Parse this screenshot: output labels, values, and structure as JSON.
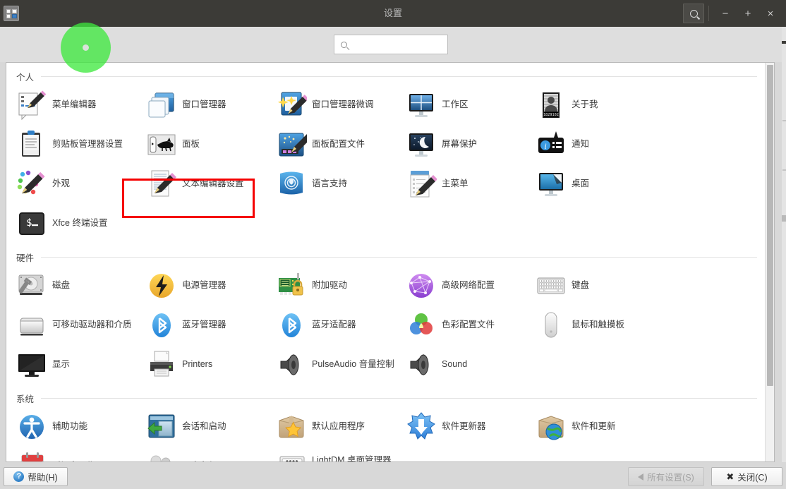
{
  "window": {
    "title": "设置",
    "icon": "settings-window-icon",
    "controls": {
      "search": "search-icon",
      "minimize": "−",
      "maximize": "+",
      "close": "×"
    }
  },
  "search": {
    "value": "",
    "placeholder": "",
    "icon": "search-icon"
  },
  "sections": [
    {
      "id": "personal",
      "title": "个人",
      "items": [
        {
          "label": "菜单编辑器",
          "icon": "menu-editor-icon"
        },
        {
          "label": "窗口管理器",
          "icon": "window-manager-icon"
        },
        {
          "label": "窗口管理器微调",
          "icon": "window-manager-tweaks-icon"
        },
        {
          "label": "工作区",
          "icon": "workspaces-icon"
        },
        {
          "label": "关于我",
          "icon": "about-me-icon",
          "badge": "1829102"
        },
        {
          "label": "剪贴板管理器设置",
          "icon": "clipboard-manager-icon"
        },
        {
          "label": "面板",
          "icon": "panel-icon",
          "highlighted": true
        },
        {
          "label": "面板配置文件",
          "icon": "panel-profiles-icon"
        },
        {
          "label": "屏幕保护",
          "icon": "screensaver-icon"
        },
        {
          "label": "通知",
          "icon": "notifications-icon"
        },
        {
          "label": "外观",
          "icon": "appearance-icon"
        },
        {
          "label": "文本编辑器设置",
          "icon": "text-editor-settings-icon"
        },
        {
          "label": "语言支持",
          "icon": "language-support-icon"
        },
        {
          "label": "主菜单",
          "icon": "main-menu-icon"
        },
        {
          "label": "桌面",
          "icon": "desktop-icon"
        },
        {
          "label": "Xfce 终端设置",
          "icon": "xfce-terminal-icon"
        }
      ]
    },
    {
      "id": "hardware",
      "title": "硬件",
      "items": [
        {
          "label": "磁盘",
          "icon": "disks-icon"
        },
        {
          "label": "电源管理器",
          "icon": "power-manager-icon"
        },
        {
          "label": "附加驱动",
          "icon": "additional-drivers-icon"
        },
        {
          "label": "高级网络配置",
          "icon": "advanced-network-icon"
        },
        {
          "label": "键盘",
          "icon": "keyboard-icon"
        },
        {
          "label": "可移动驱动器和介质",
          "icon": "removable-drives-icon"
        },
        {
          "label": "蓝牙管理器",
          "icon": "bluetooth-manager-icon"
        },
        {
          "label": "蓝牙适配器",
          "icon": "bluetooth-adapter-icon"
        },
        {
          "label": "色彩配置文件",
          "icon": "color-profiles-icon"
        },
        {
          "label": "鼠标和触摸板",
          "icon": "mouse-touchpad-icon"
        },
        {
          "label": "显示",
          "icon": "display-icon"
        },
        {
          "label": "Printers",
          "icon": "printers-icon"
        },
        {
          "label": "PulseAudio 音量控制",
          "icon": "pulseaudio-icon"
        },
        {
          "label": "Sound",
          "icon": "sound-icon"
        }
      ]
    },
    {
      "id": "system",
      "title": "系统",
      "items": [
        {
          "label": "辅助功能",
          "icon": "accessibility-icon"
        },
        {
          "label": "会话和启动",
          "icon": "session-startup-icon"
        },
        {
          "label": "默认应用程序",
          "icon": "default-applications-icon"
        },
        {
          "label": "软件更新器",
          "icon": "software-updater-icon"
        },
        {
          "label": "软件和更新",
          "icon": "software-and-updates-icon"
        },
        {
          "label": "时间和日期",
          "icon": "time-date-icon"
        },
        {
          "label": "用户和组",
          "icon": "users-groups-icon"
        },
        {
          "label": "LightDM 桌面管理器\n（GTK+ 界面）设置",
          "icon": "lightdm-settings-icon"
        }
      ]
    }
  ],
  "footer": {
    "help_label": "帮助(H)",
    "all_settings_label": "所有设置(S)",
    "close_label": "关闭(C)"
  },
  "colors": {
    "titlebar": "#3c3b37",
    "highlight": "#f50000",
    "click_indicator": "#3ce83c",
    "pane_background": "#ffffff"
  }
}
